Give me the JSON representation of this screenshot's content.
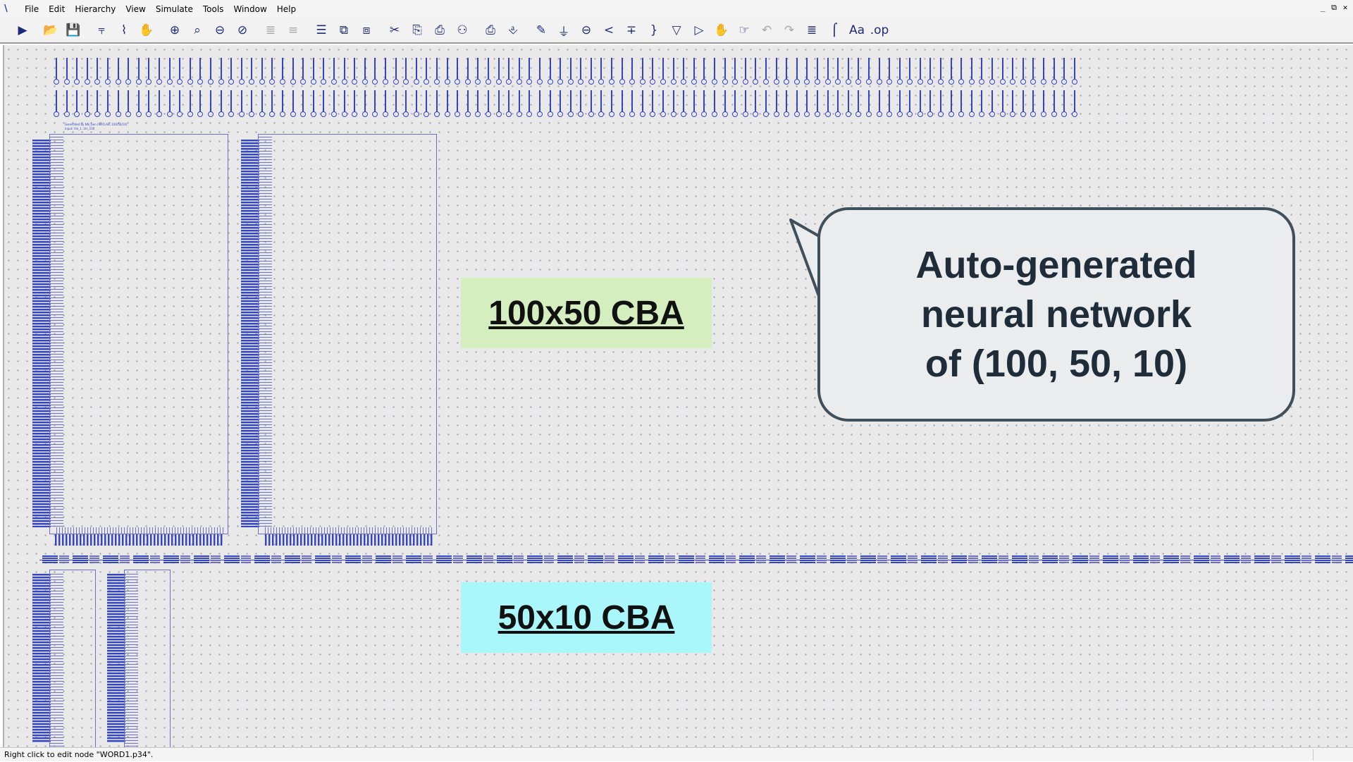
{
  "window": {
    "menu": [
      "File",
      "Edit",
      "Hierarchy",
      "View",
      "Simulate",
      "Tools",
      "Window",
      "Help"
    ],
    "controls": [
      "_",
      "⧉",
      "✕"
    ]
  },
  "toolbar": {
    "buttons": [
      {
        "name": "run-icon",
        "glyph": "▶"
      },
      {
        "name": "open-icon",
        "glyph": "📂"
      },
      {
        "name": "save-icon",
        "glyph": "💾"
      },
      {
        "name": "hierarchy-icon",
        "glyph": "⫧"
      },
      {
        "name": "wire-icon",
        "glyph": "⌇"
      },
      {
        "name": "select-icon",
        "glyph": "✋"
      },
      {
        "name": "zoom-in-icon",
        "glyph": "⊕"
      },
      {
        "name": "zoom-icon",
        "glyph": "⌕"
      },
      {
        "name": "zoom-out-icon",
        "glyph": "⊖"
      },
      {
        "name": "zoom-fit-icon",
        "glyph": "⊘"
      },
      {
        "name": "align-icon",
        "glyph": "≣"
      },
      {
        "name": "distribute-icon",
        "glyph": "≡"
      },
      {
        "name": "layer-icon",
        "glyph": "☰"
      },
      {
        "name": "stack-icon",
        "glyph": "⧉"
      },
      {
        "name": "group-icon",
        "glyph": "⧈"
      },
      {
        "name": "cut-icon",
        "glyph": "✂"
      },
      {
        "name": "copy-icon",
        "glyph": "⎘"
      },
      {
        "name": "paste-icon",
        "glyph": "⎙"
      },
      {
        "name": "find-icon",
        "glyph": "⚇"
      },
      {
        "name": "print-preview-icon",
        "glyph": "⎙"
      },
      {
        "name": "print-icon",
        "glyph": "⎀"
      },
      {
        "name": "pencil-icon",
        "glyph": "✎"
      },
      {
        "name": "ground-icon",
        "glyph": "⏚"
      },
      {
        "name": "probe-icon",
        "glyph": "⊖"
      },
      {
        "name": "less-than-icon",
        "glyph": "<"
      },
      {
        "name": "plus-icon",
        "glyph": "∓"
      },
      {
        "name": "brace-icon",
        "glyph": "}"
      },
      {
        "name": "diode-icon",
        "glyph": "▽"
      },
      {
        "name": "gate-icon",
        "glyph": "▷"
      },
      {
        "name": "hand-icon",
        "glyph": "✋"
      },
      {
        "name": "pan-icon",
        "glyph": "☞"
      },
      {
        "name": "undo-icon",
        "glyph": "↶"
      },
      {
        "name": "redo-icon",
        "glyph": "↷"
      },
      {
        "name": "format-icon",
        "glyph": "≣"
      },
      {
        "name": "bracket-icon",
        "glyph": "⌠"
      },
      {
        "name": "font-icon",
        "glyph": "Aa"
      },
      {
        "name": "op-icon",
        "glyph": ".op"
      }
    ]
  },
  "labels": {
    "cba_100x50": "100x50 CBA",
    "cba_50x10": "50x10 CBA",
    "callout": "Auto-generated\nneural network\nof (100, 50, 10)",
    "colors": {
      "cba_100x50_bg": "#d4eec0",
      "cba_50x10_bg": "#a9f7fb",
      "wire": "#3344c4"
    }
  },
  "schematic": {
    "tiny_caption_1": "Generated by NN_Gen (MATLAB, 100/50/10)",
    "tiny_caption_2": "Input: Vin_1..Vin_100"
  },
  "status": {
    "text": "Right click to edit node \"WORD1.p34\"."
  }
}
